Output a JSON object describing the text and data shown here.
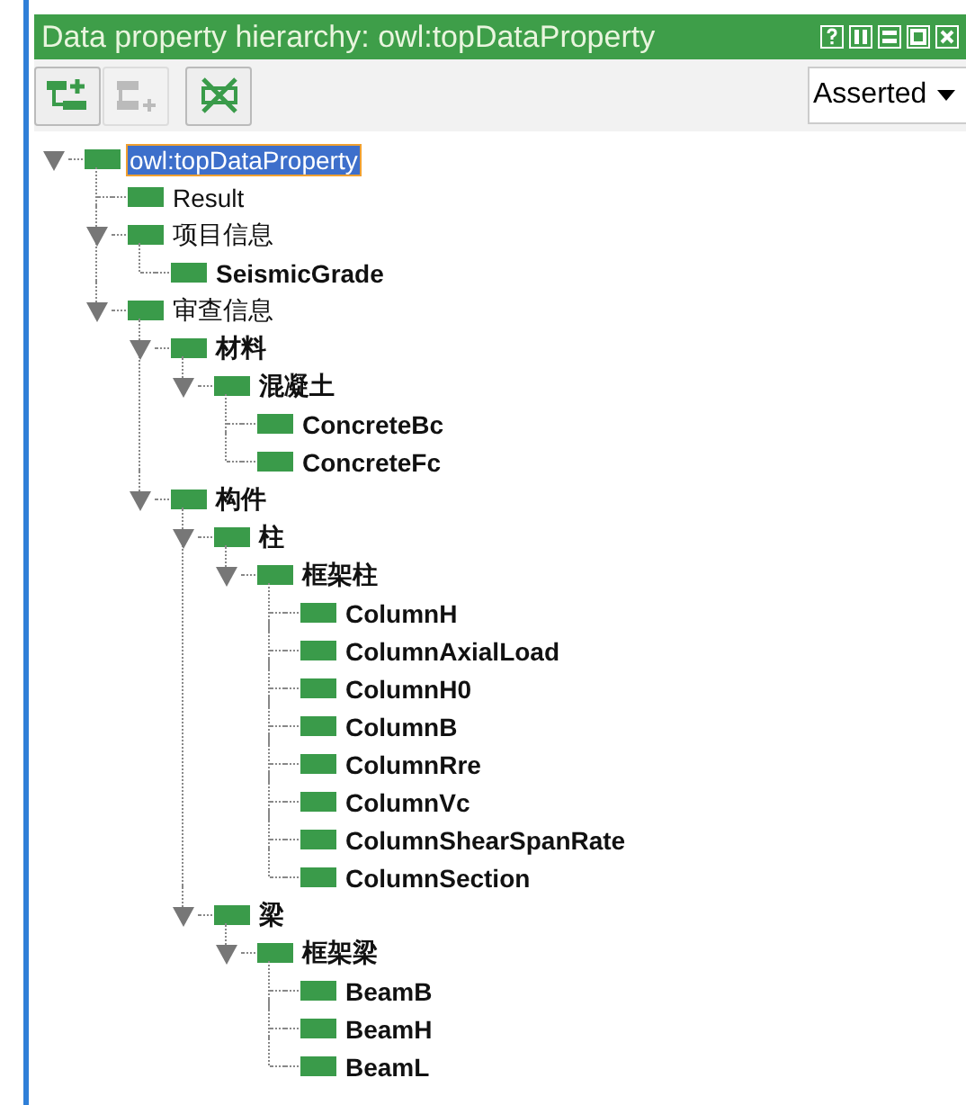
{
  "panel": {
    "title": "Data property hierarchy: owl:topDataProperty"
  },
  "title_buttons": [
    {
      "kind": "help"
    },
    {
      "kind": "split"
    },
    {
      "kind": "minimize"
    },
    {
      "kind": "maximize"
    },
    {
      "kind": "close"
    }
  ],
  "toolbar": [
    {
      "kind": "add-sub",
      "disabled": false
    },
    {
      "kind": "add-sibling",
      "disabled": true
    },
    {
      "kind": "delete",
      "disabled": false
    }
  ],
  "view_dropdown": {
    "value": "Asserted"
  },
  "tree": [
    {
      "label": "owl:topDataProperty",
      "bold": false,
      "selected": true,
      "expanded": true,
      "children": [
        {
          "label": "Result",
          "bold": false,
          "selected": false
        },
        {
          "label": "项目信息",
          "bold": false,
          "selected": false,
          "expanded": true,
          "children": [
            {
              "label": "SeismicGrade",
              "bold": true,
              "selected": false
            }
          ]
        },
        {
          "label": "审查信息",
          "bold": false,
          "selected": false,
          "expanded": true,
          "children": [
            {
              "label": "材料",
              "bold": true,
              "selected": false,
              "expanded": true,
              "children": [
                {
                  "label": "混凝土",
                  "bold": true,
                  "selected": false,
                  "expanded": true,
                  "children": [
                    {
                      "label": "ConcreteBc",
                      "bold": true,
                      "selected": false
                    },
                    {
                      "label": "ConcreteFc",
                      "bold": true,
                      "selected": false
                    }
                  ]
                }
              ]
            },
            {
              "label": "构件",
              "bold": true,
              "selected": false,
              "expanded": true,
              "children": [
                {
                  "label": "柱",
                  "bold": true,
                  "selected": false,
                  "expanded": true,
                  "children": [
                    {
                      "label": "框架柱",
                      "bold": true,
                      "selected": false,
                      "expanded": true,
                      "children": [
                        {
                          "label": "ColumnH",
                          "bold": true,
                          "selected": false
                        },
                        {
                          "label": "ColumnAxialLoad",
                          "bold": true,
                          "selected": false
                        },
                        {
                          "label": "ColumnH0",
                          "bold": true,
                          "selected": false
                        },
                        {
                          "label": "ColumnB",
                          "bold": true,
                          "selected": false
                        },
                        {
                          "label": "ColumnRre",
                          "bold": true,
                          "selected": false
                        },
                        {
                          "label": "ColumnVc",
                          "bold": true,
                          "selected": false
                        },
                        {
                          "label": "ColumnShearSpanRate",
                          "bold": true,
                          "selected": false
                        },
                        {
                          "label": "ColumnSection",
                          "bold": true,
                          "selected": false
                        }
                      ]
                    }
                  ]
                },
                {
                  "label": "梁",
                  "bold": true,
                  "selected": false,
                  "expanded": true,
                  "children": [
                    {
                      "label": "框架梁",
                      "bold": true,
                      "selected": false,
                      "expanded": true,
                      "children": [
                        {
                          "label": "BeamB",
                          "bold": true,
                          "selected": false
                        },
                        {
                          "label": "BeamH",
                          "bold": true,
                          "selected": false
                        },
                        {
                          "label": "BeamL",
                          "bold": true,
                          "selected": false
                        }
                      ]
                    }
                  ]
                }
              ]
            }
          ]
        }
      ]
    }
  ]
}
